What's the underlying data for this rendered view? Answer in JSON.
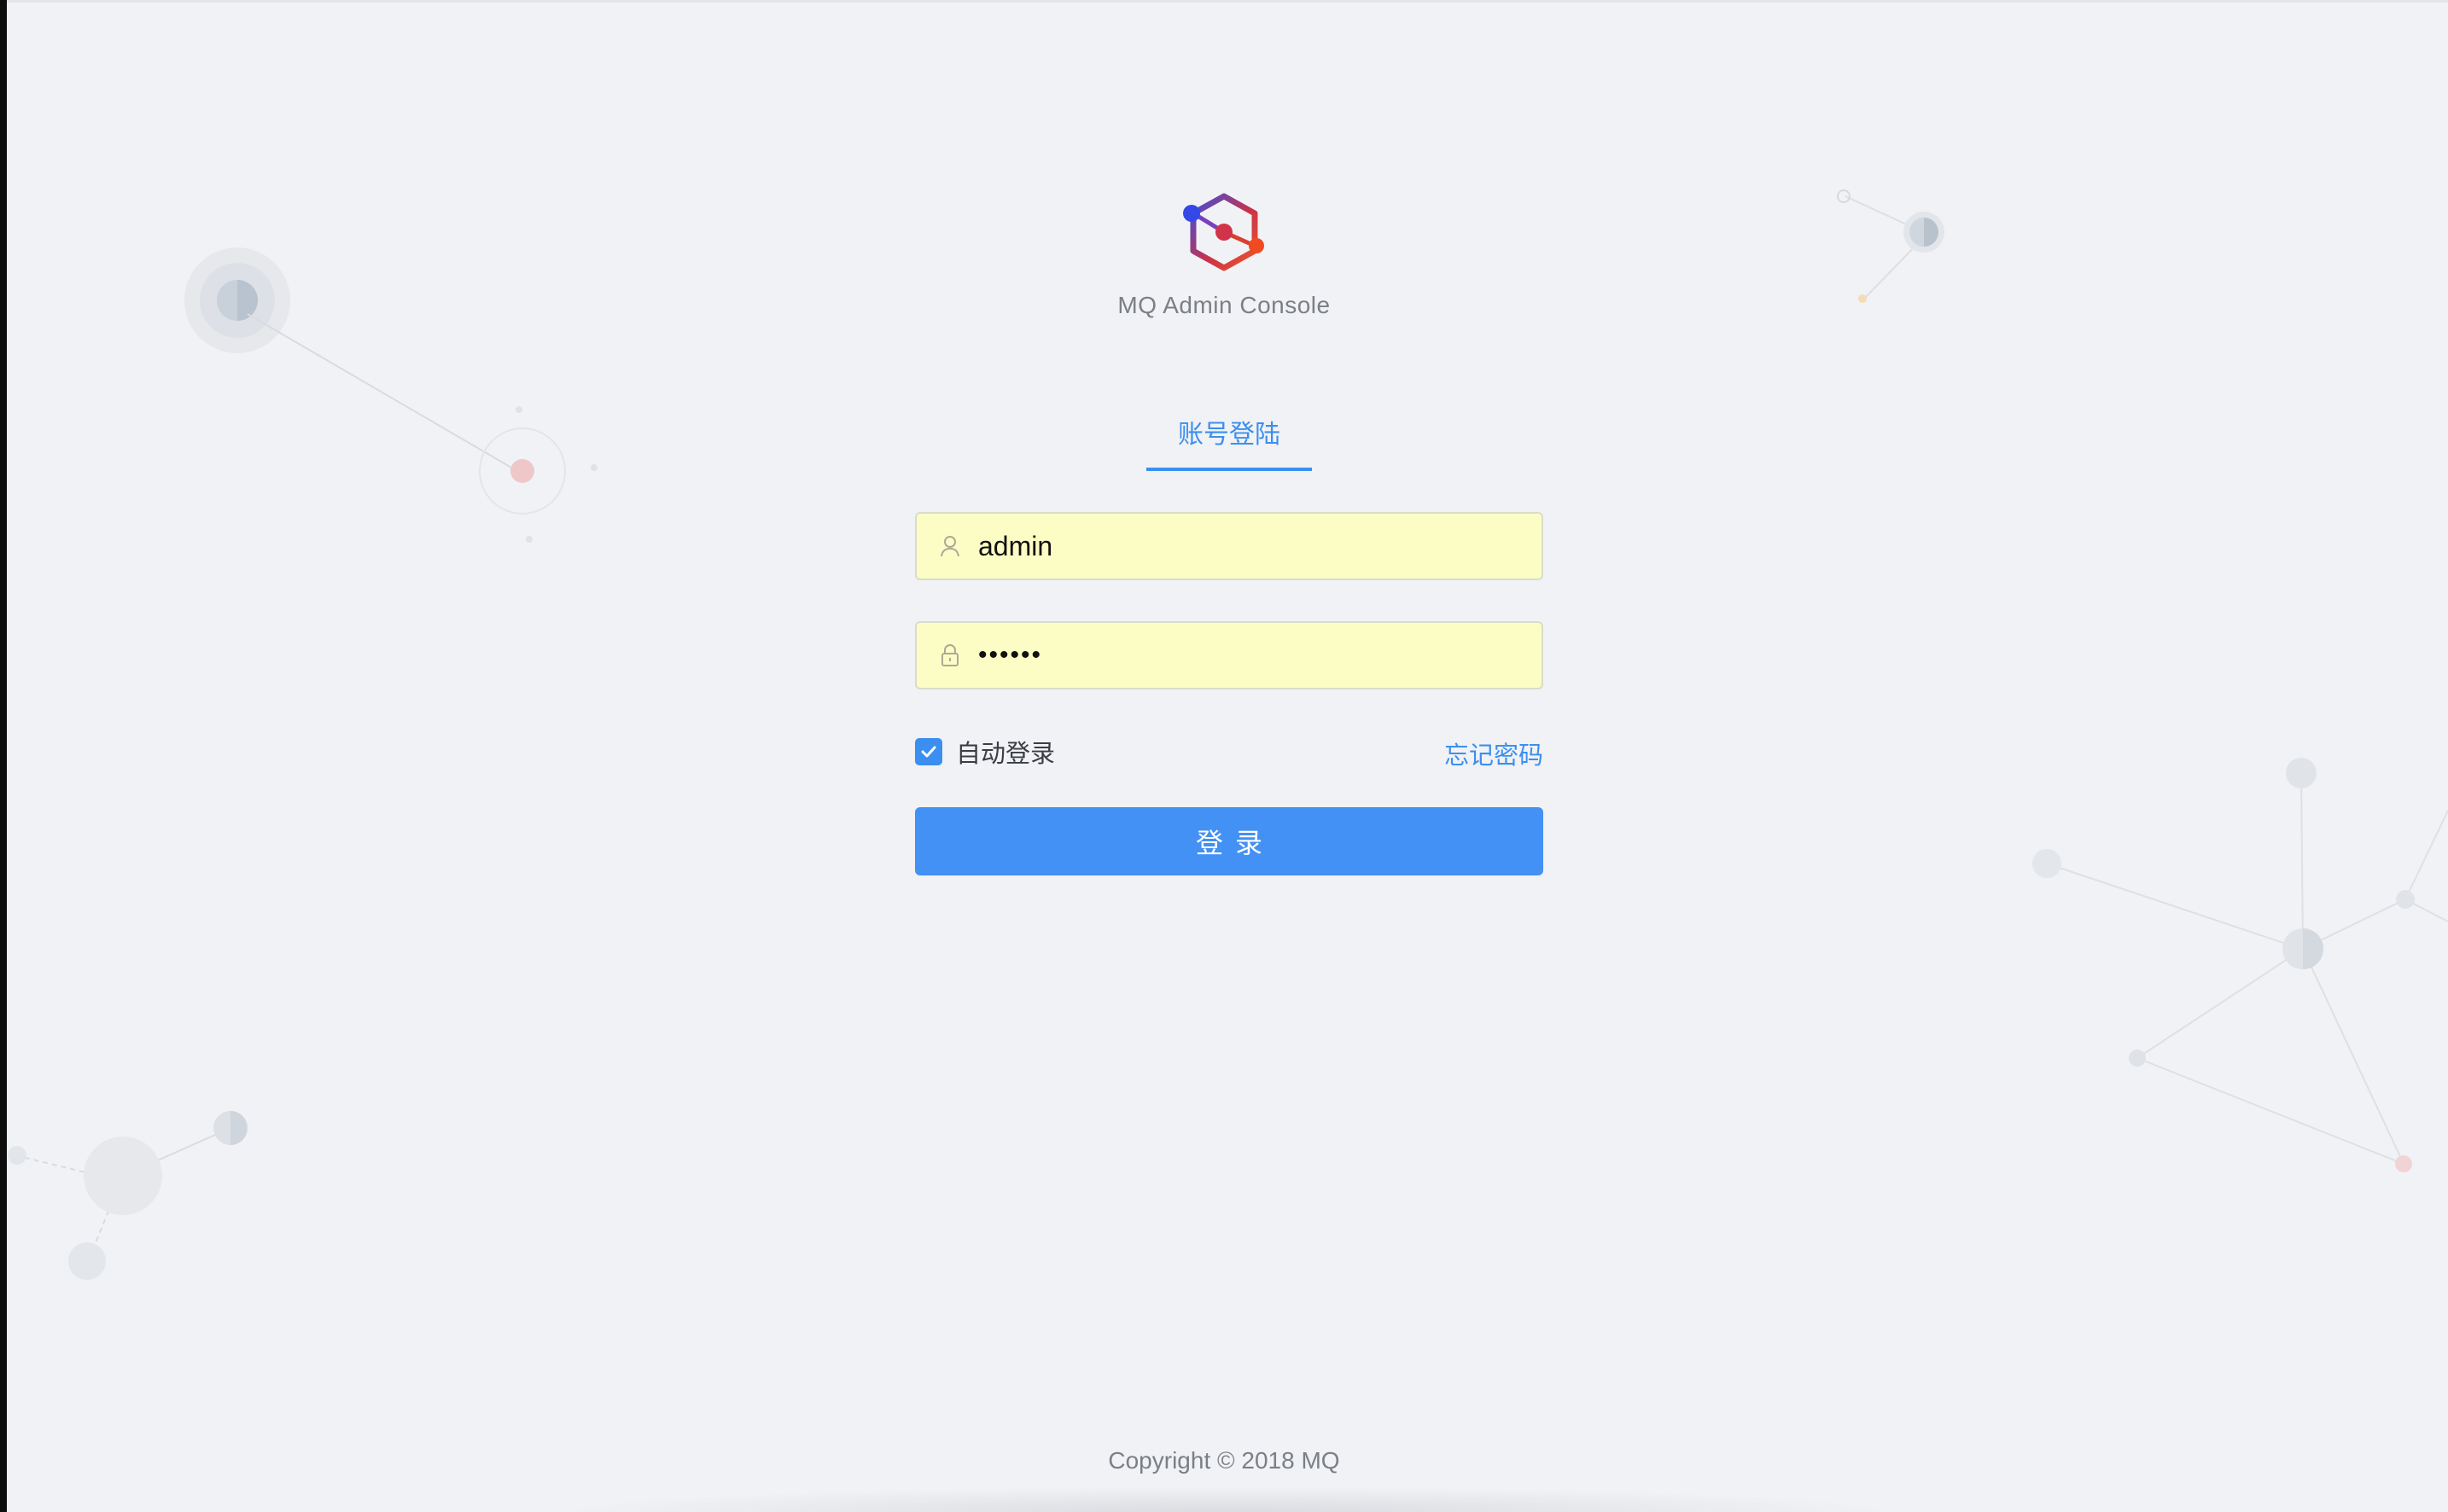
{
  "app": {
    "title": "MQ Admin Console",
    "logo_icon": "hexagon-network-logo"
  },
  "login": {
    "tab_label": "账号登陆",
    "username": {
      "value": "admin",
      "icon": "user-icon"
    },
    "password": {
      "value": "••••••",
      "icon": "lock-icon"
    },
    "remember": {
      "label": "自动登录",
      "checked": true
    },
    "forgot_label": "忘记密码",
    "submit_label": "登录"
  },
  "footer": {
    "copyright": "Copyright © 2018 MQ"
  },
  "colors": {
    "accent": "#3b8ff0",
    "button": "#4391f4",
    "background": "#f1f2f5",
    "input_fill": "#fcfdc4"
  }
}
